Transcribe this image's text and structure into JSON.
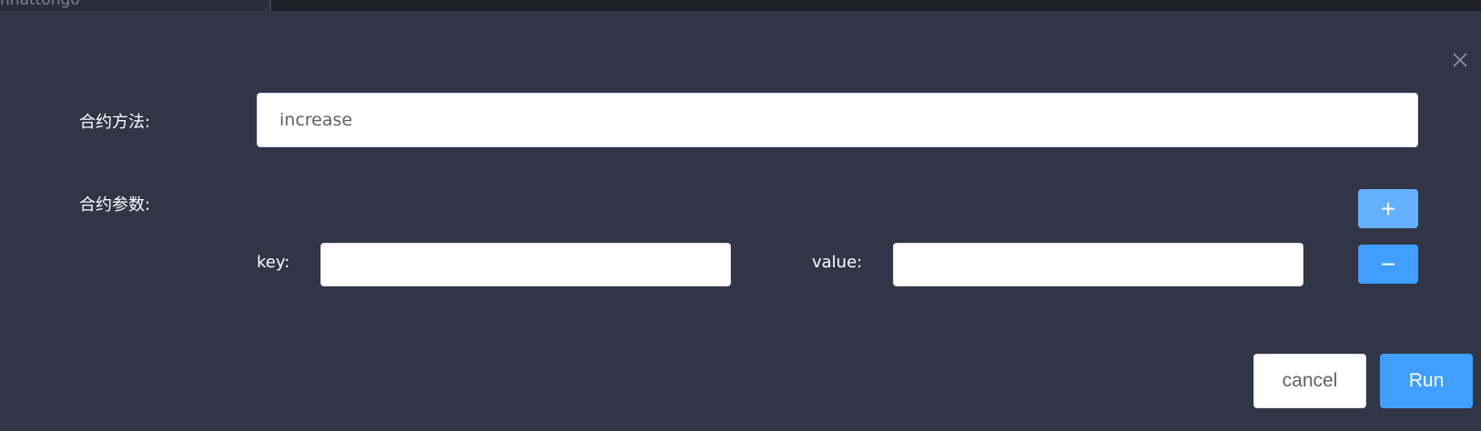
{
  "background": {
    "crumb_text": "nnattongo"
  },
  "dialog": {
    "close_icon": "close-icon",
    "method_label": "合约方法:",
    "method_value": "increase",
    "params_label": "合约参数:",
    "key_label": "key:",
    "key_value": "",
    "value_label": "value:",
    "value_value": "",
    "add_icon": "plus-icon",
    "add_label": "+",
    "remove_icon": "minus-icon",
    "remove_label": "−",
    "cancel_label": "cancel",
    "run_label": "Run"
  },
  "colors": {
    "dialog_bg": "#313546",
    "primary": "#409eff",
    "primary_light": "#66b1ff",
    "label_text": "#ffffff"
  }
}
